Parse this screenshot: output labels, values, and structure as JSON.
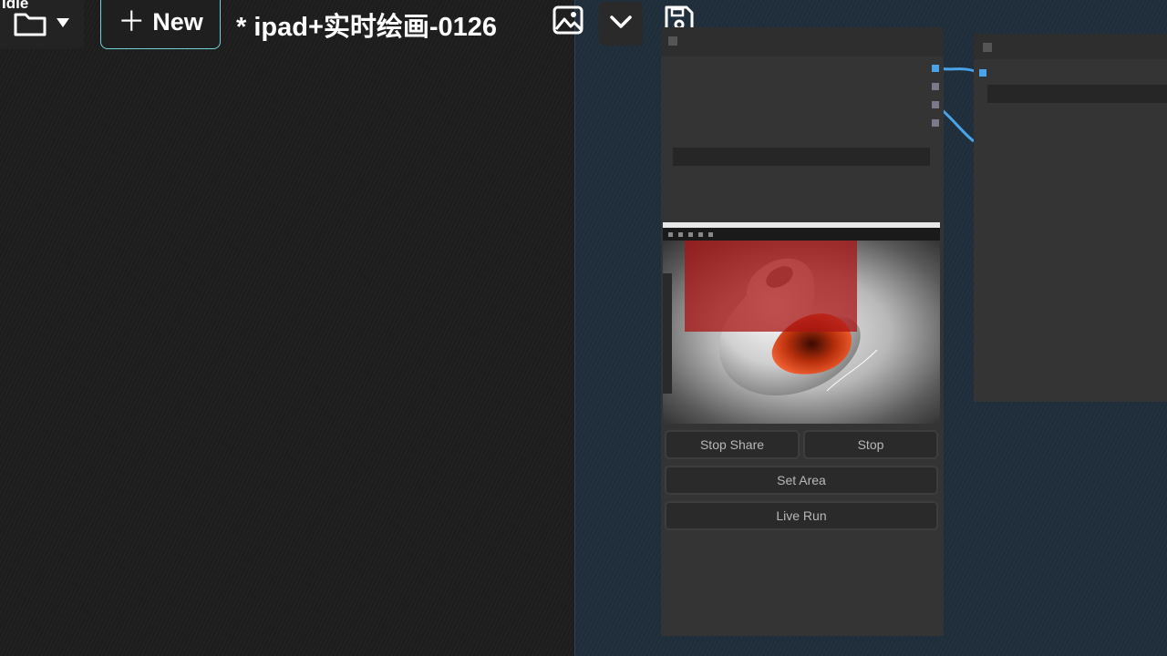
{
  "status": {
    "text": "Idle"
  },
  "toolbar": {
    "new_label": "New",
    "workflow_title": "* ipad+实时绘画-0126",
    "icons": [
      "folder-icon",
      "caret-down-icon",
      "plus-icon",
      "image-icon",
      "chevron-down-icon",
      "save-icon"
    ]
  },
  "node": {
    "buttons": {
      "stop_share": "Stop Share",
      "stop": "Stop",
      "set_area": "Set Area",
      "live_run": "Live Run"
    }
  },
  "colors": {
    "accent": "#6fd3d9",
    "canvas_bg": "#1f2f3b",
    "node_bg": "#343434",
    "link": "#4aa3e8",
    "selection": "#aa1414"
  }
}
